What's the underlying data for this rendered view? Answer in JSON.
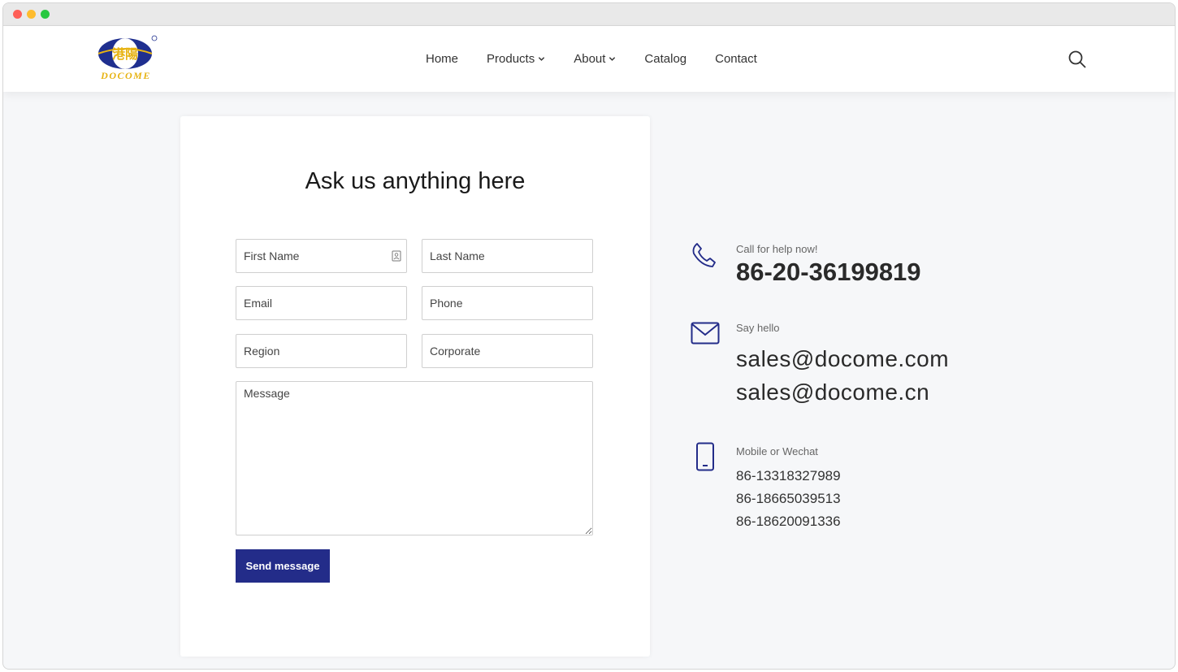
{
  "nav": {
    "items": [
      {
        "label": "Home",
        "dropdown": false
      },
      {
        "label": "Products",
        "dropdown": true
      },
      {
        "label": "About",
        "dropdown": true
      },
      {
        "label": "Catalog",
        "dropdown": false
      },
      {
        "label": "Contact",
        "dropdown": false
      }
    ]
  },
  "logo": {
    "brand": "DOCOME",
    "chinese": "港陽"
  },
  "form": {
    "title": "Ask us anything here",
    "first_name_placeholder": "First Name",
    "last_name_placeholder": "Last Name",
    "email_placeholder": "Email",
    "phone_placeholder": "Phone",
    "region_placeholder": "Region",
    "corporate_placeholder": "Corporate",
    "message_placeholder": "Message",
    "send_label": "Send message"
  },
  "contact": {
    "call_label": "Call for help now!",
    "phone": "86-20-36199819",
    "email_label": "Say hello",
    "emails": [
      "sales@docome.com",
      "sales@docome.cn"
    ],
    "mobile_label": "Mobile or Wechat",
    "mobiles": [
      "86-13318327989",
      "86-18665039513",
      "86-18620091336"
    ]
  },
  "colors": {
    "accent": "#232c89",
    "logo_blue": "#1f2f8f",
    "logo_gold": "#e7b312"
  }
}
